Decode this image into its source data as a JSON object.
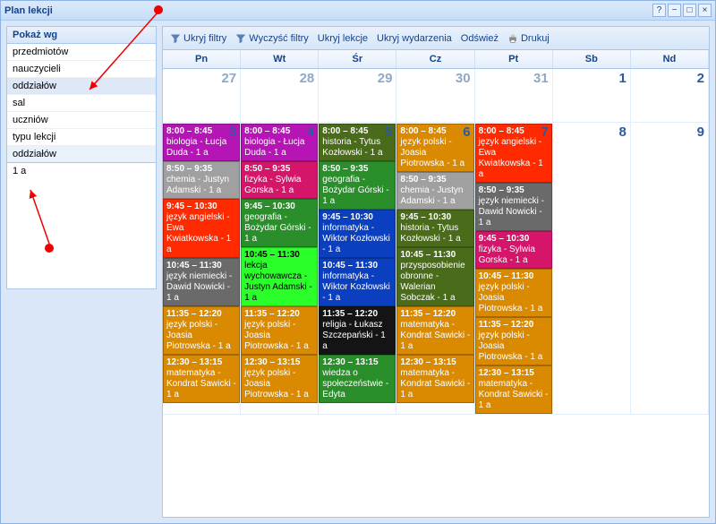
{
  "window": {
    "title": "Plan lekcji",
    "buttons": {
      "help": "?",
      "min": "−",
      "max": "□",
      "close": "×"
    }
  },
  "sidebar": {
    "filterLabel": "Pokaż wg",
    "filterItems": [
      "przedmiotów",
      "nauczycieli",
      "oddziałów",
      "sal",
      "uczniów",
      "typu lekcji"
    ],
    "filterSelectedIndex": 2,
    "subHeader": "oddziałów",
    "subValue": "1 a"
  },
  "toolbar": {
    "items": [
      "Ukryj filtry",
      "Wyczyść filtry",
      "Ukryj lekcje",
      "Ukryj wydarzenia",
      "Odśwież",
      "Drukuj"
    ]
  },
  "calendar": {
    "dayNames": [
      "Pn",
      "Wt",
      "Śr",
      "Cz",
      "Pt",
      "Sb",
      "Nd"
    ],
    "week1": [
      {
        "num": "27"
      },
      {
        "num": "28"
      },
      {
        "num": "29"
      },
      {
        "num": "30"
      },
      {
        "num": "31"
      },
      {
        "num": "1",
        "strong": true
      },
      {
        "num": "2",
        "strong": true
      }
    ],
    "week2Nums": [
      "3",
      "4",
      "5",
      "6",
      "7",
      "8",
      "9"
    ],
    "lessons": {
      "0": [
        {
          "time": "8:00 – 8:45",
          "text": "biologia - Łucja Duda - 1 a",
          "color": "#b515b5"
        },
        {
          "time": "8:50 – 9:35",
          "text": "chemia - Justyn Adamski - 1 a",
          "color": "#a0a0a0"
        },
        {
          "time": "9:45 – 10:30",
          "text": "język angielski - Ewa Kwiatkowska - 1 a",
          "color": "#ff2a00"
        },
        {
          "time": "10:45 – 11:30",
          "text": "język niemiecki - Dawid Nowicki - 1 a",
          "color": "#6a6a6a"
        },
        {
          "time": "11:35 – 12:20",
          "text": "język polski - Joasia Piotrowska - 1 a",
          "color": "#d98a00"
        },
        {
          "time": "12:30 – 13:15",
          "text": "matematyka - Kondrat Sawicki - 1 a",
          "color": "#d98a00"
        }
      ],
      "1": [
        {
          "time": "8:00 – 8:45",
          "text": "biologia - Łucja Duda - 1 a",
          "color": "#b515b5"
        },
        {
          "time": "8:50 – 9:35",
          "text": "fizyka - Sylwia Gorska - 1 a",
          "color": "#d41569"
        },
        {
          "time": "9:45 – 10:30",
          "text": "geografia - Bożydar Górski - 1 a",
          "color": "#2a8f2a"
        },
        {
          "time": "10:45 – 11:30",
          "text": "lekcja wychowawcza - Justyn Adamski - 1 a",
          "color": "#2aff2a",
          "dark": true
        },
        {
          "time": "11:35 – 12:20",
          "text": "język polski - Joasia Piotrowska - 1 a",
          "color": "#d98a00"
        },
        {
          "time": "12:30 – 13:15",
          "text": "język polski - Joasia Piotrowska - 1 a",
          "color": "#d98a00"
        }
      ],
      "2": [
        {
          "time": "8:00 – 8:45",
          "text": "historia - Tytus Kozłowski - 1 a",
          "color": "#4a6b1a"
        },
        {
          "time": "8:50 – 9:35",
          "text": "geografia - Bożydar Górski - 1 a",
          "color": "#2a8f2a"
        },
        {
          "time": "9:45 – 10:30",
          "text": "informatyka - Wiktor Kozłowski - 1 a",
          "color": "#0a3fbf"
        },
        {
          "time": "10:45 – 11:30",
          "text": "informatyka - Wiktor Kozłowski - 1 a",
          "color": "#0a3fbf"
        },
        {
          "time": "11:35 – 12:20",
          "text": "religia - Łukasz Szczepański - 1 a",
          "color": "#141414"
        },
        {
          "time": "12:30 – 13:15",
          "text": "wiedza o społeczeństwie - Edyta",
          "color": "#2a8f2a"
        }
      ],
      "3": [
        {
          "time": "8:00 – 8:45",
          "text": "język polski - Joasia Piotrowska - 1 a",
          "color": "#d98a00"
        },
        {
          "time": "8:50 – 9:35",
          "text": "chemia - Justyn Adamski - 1 a",
          "color": "#a0a0a0"
        },
        {
          "time": "9:45 – 10:30",
          "text": "historia - Tytus Kozłowski - 1 a",
          "color": "#4a6b1a"
        },
        {
          "time": "10:45 – 11:30",
          "text": "przysposobienie obronne - Walerian Sobczak - 1 a",
          "color": "#4a6b1a"
        },
        {
          "time": "11:35 – 12:20",
          "text": "matematyka - Kondrat Sawicki - 1 a",
          "color": "#d98a00"
        },
        {
          "time": "12:30 – 13:15",
          "text": "matematyka - Kondrat Sawicki - 1 a",
          "color": "#d98a00"
        }
      ],
      "4": [
        {
          "time": "8:00 – 8:45",
          "text": "język angielski - Ewa Kwiatkowska - 1 a",
          "color": "#ff2a00"
        },
        {
          "time": "8:50 – 9:35",
          "text": "język niemiecki - Dawid Nowicki - 1 a",
          "color": "#6a6a6a"
        },
        {
          "time": "9:45 – 10:30",
          "text": "fizyka - Sylwia Gorska - 1 a",
          "color": "#d41569"
        },
        {
          "time": "10:45 – 11:30",
          "text": "język polski - Joasia Piotrowska - 1 a",
          "color": "#d98a00"
        },
        {
          "time": "11:35 – 12:20",
          "text": "język polski - Joasia Piotrowska - 1 a",
          "color": "#d98a00"
        },
        {
          "time": "12:30 – 13:15",
          "text": "matematyka - Kondrat Sawicki - 1 a",
          "color": "#d98a00"
        }
      ]
    }
  }
}
